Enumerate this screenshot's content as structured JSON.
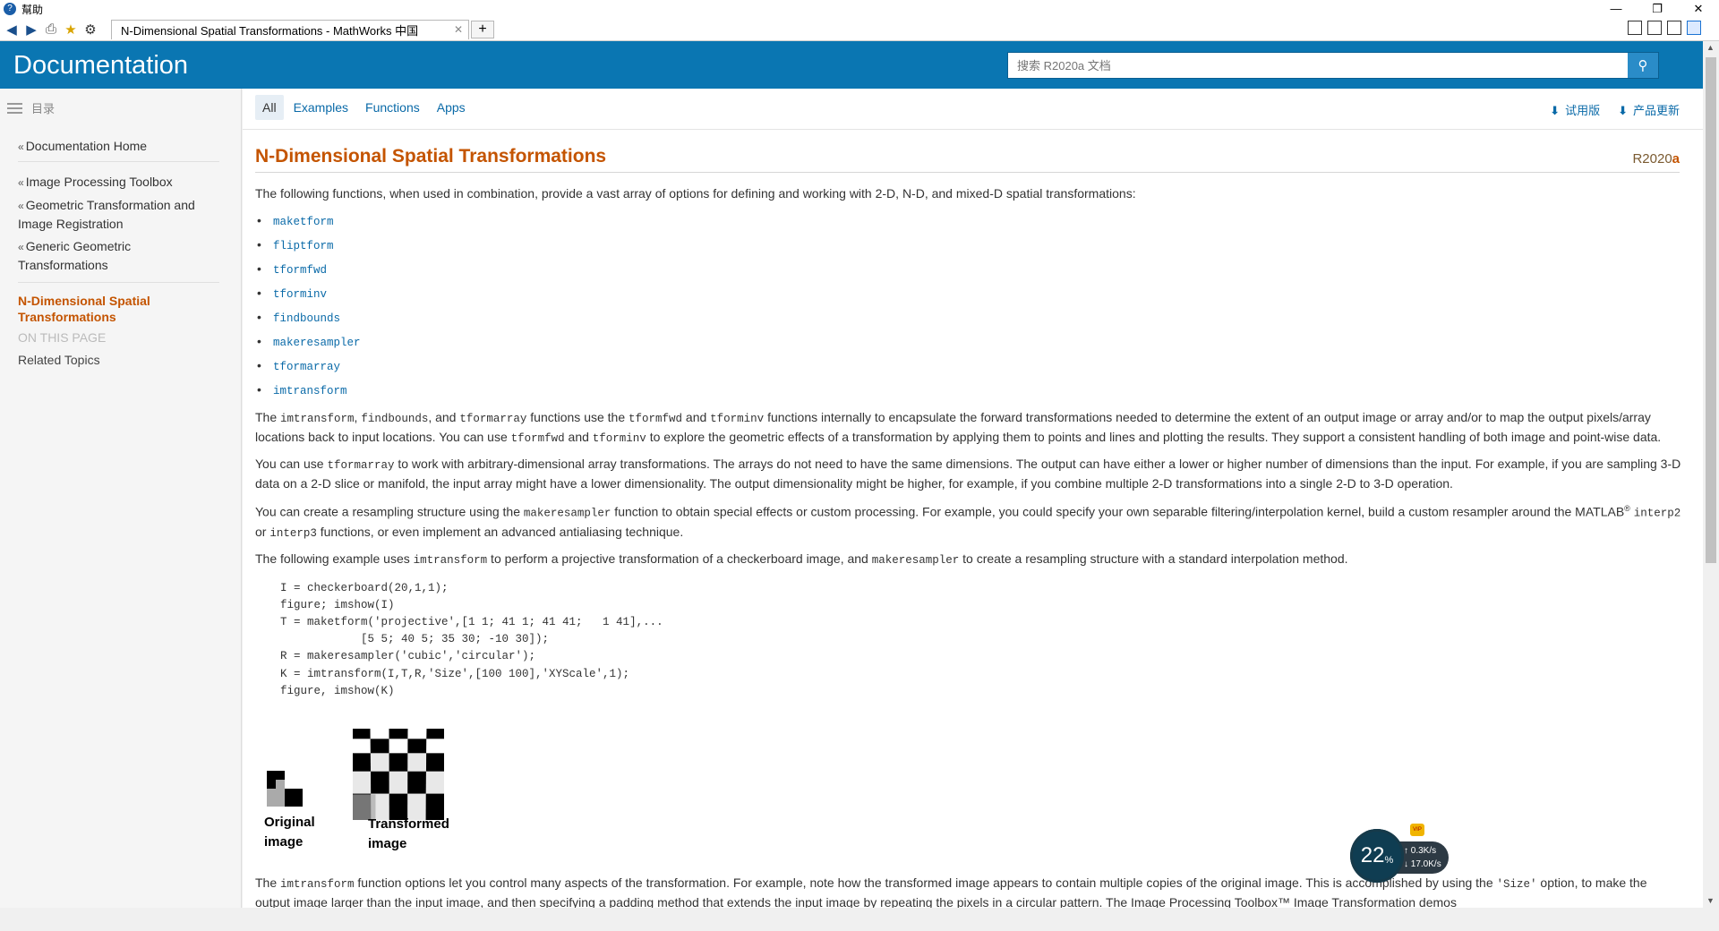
{
  "window": {
    "title": "幫助",
    "controls": [
      "—",
      "❐",
      "✕"
    ]
  },
  "tabbar": {
    "tab_title": "N-Dimensional Spatial Transformations - MathWorks 中国",
    "close": "✕",
    "new_tab": "+"
  },
  "header": {
    "title": "Documentation",
    "search_placeholder": "搜索 R2020a 文档"
  },
  "sidebar": {
    "toc_label": "目录",
    "links": [
      "Documentation Home",
      "Image Processing Toolbox",
      "Geometric Transformation and Image Registration",
      "Generic Geometric Transformations"
    ],
    "current": "N-Dimensional Spatial Transformations",
    "on_this_page": "ON THIS PAGE",
    "related": "Related Topics"
  },
  "filters": [
    "All",
    "Examples",
    "Functions",
    "Apps"
  ],
  "actions": {
    "trial": "试用版",
    "updates": "产品更新"
  },
  "page": {
    "title": "N-Dimensional Spatial Transformations",
    "release_prefix": "R2020",
    "release_suffix": "a",
    "intro": "The following functions, when used in combination, provide a vast array of options for defining and working with 2-D, N-D, and mixed-D spatial transformations:",
    "functions": [
      "maketform",
      "fliptform",
      "tformfwd",
      "tforminv",
      "findbounds",
      "makeresampler",
      "tformarray",
      "imtransform"
    ],
    "p2": {
      "c1": "imtransform",
      "t1": ", ",
      "c2": "findbounds",
      "t2": ", and ",
      "c3": "tformarray",
      "t3": " functions use the ",
      "c4": "tformfwd",
      "t4": " and ",
      "c5": "tforminv",
      "t5": " functions internally to encapsulate the forward transformations needed to determine the extent of an output image or array and/or to map the output pixels/array locations back to input locations. You can use ",
      "c6": "tformfwd",
      "t6": " and ",
      "c7": "tforminv",
      "t7": " to explore the geometric effects of a transformation by applying them to points and lines and plotting the results. They support a consistent handling of both image and point-wise data.",
      "lead": "The "
    },
    "p3": {
      "lead": "You can use ",
      "c1": "tformarray",
      "t1": " to work with arbitrary-dimensional array transformations. The arrays do not need to have the same dimensions. The output can have either a lower or higher number of dimensions than the input. For example, if you are sampling 3-D data on a 2-D slice or manifold, the input array might have a lower dimensionality. The output dimensionality might be higher, for example, if you combine multiple 2-D transformations into a single 2-D to 3-D operation."
    },
    "p4": {
      "lead": "You can create a resampling structure using the ",
      "c1": "makeresampler",
      "t1": " function to obtain special effects or custom processing. For example, you could specify your own separable filtering/interpolation kernel, build a custom resampler around the MATLAB",
      "reg": "®",
      "c2": "interp2",
      "t2": " or ",
      "c3": "interp3",
      "t3": " functions, or even implement an advanced antialiasing technique."
    },
    "p5": {
      "lead": "The following example uses ",
      "c1": "imtransform",
      "t1": " to perform a projective transformation of a checkerboard image, and ",
      "c2": "makeresampler",
      "t2": " to create a resampling structure with a standard interpolation method."
    },
    "code": "I = checkerboard(20,1,1);\nfigure; imshow(I)\nT = maketform('projective',[1 1; 41 1; 41 41;   1 41],...\n            [5 5; 40 5; 35 30; -10 30]);\nR = makeresampler('cubic','circular');\nK = imtransform(I,T,R,'Size',[100 100],'XYScale',1);\nfigure, imshow(K)",
    "fig_original": "Original\nimage",
    "fig_transformed": "Transformed\nimage",
    "p6": {
      "lead": "The ",
      "c1": "imtransform",
      "t1": " function options let you control many aspects of the transformation. For example, note how the transformed image appears to contain multiple copies of the original image. This is accomplished by using the ",
      "c2": "'Size'",
      "t2": " option, to make the output image larger than the input image, and then specifying a padding method that extends the input image by repeating the pixels in a circular pattern. The Image Processing Toolbox™ Image Transformation demos"
    }
  },
  "netwidget": {
    "percent": "22",
    "unit": "%",
    "up": "↑ 0.3K/s",
    "down": "↓ 17.0K/s",
    "vip": "VIP"
  }
}
